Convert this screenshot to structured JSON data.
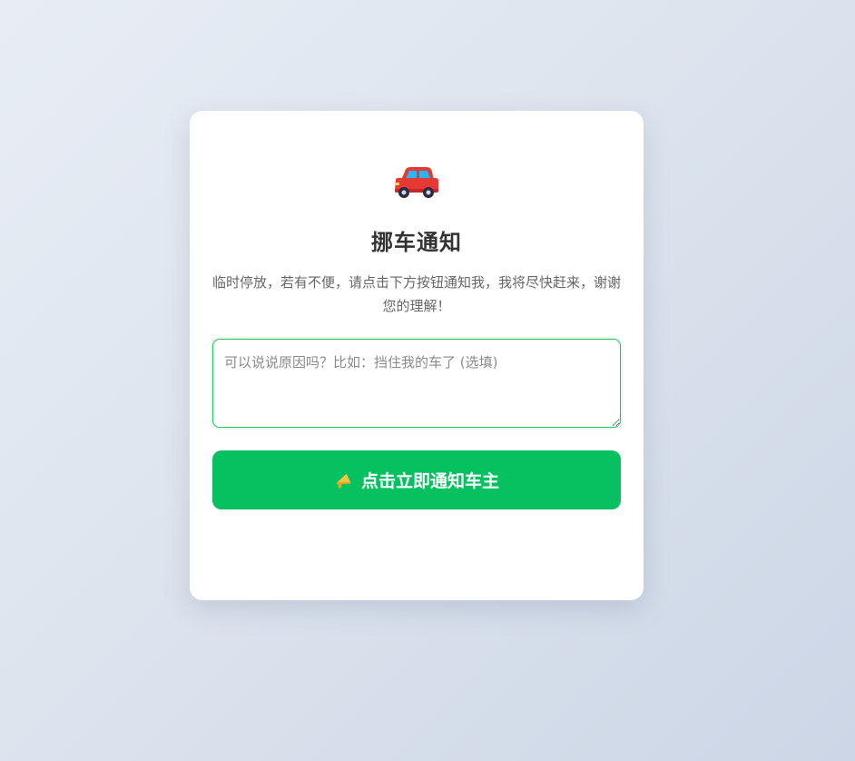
{
  "card": {
    "icon": "car-icon",
    "title": "挪车通知",
    "description": "临时停放，若有不便，请点击下方按钮通知我，我将尽快赶来，谢谢您的理解！"
  },
  "reason_input": {
    "value": "",
    "placeholder": "可以说说原因吗？比如：挡住我的车了 (选填)"
  },
  "notify_button": {
    "icon": "megaphone-icon",
    "label": "点击立即通知车主"
  },
  "colors": {
    "accent": "#07c160",
    "title": "#333333",
    "text": "#666666",
    "background": "#dde4ee"
  }
}
